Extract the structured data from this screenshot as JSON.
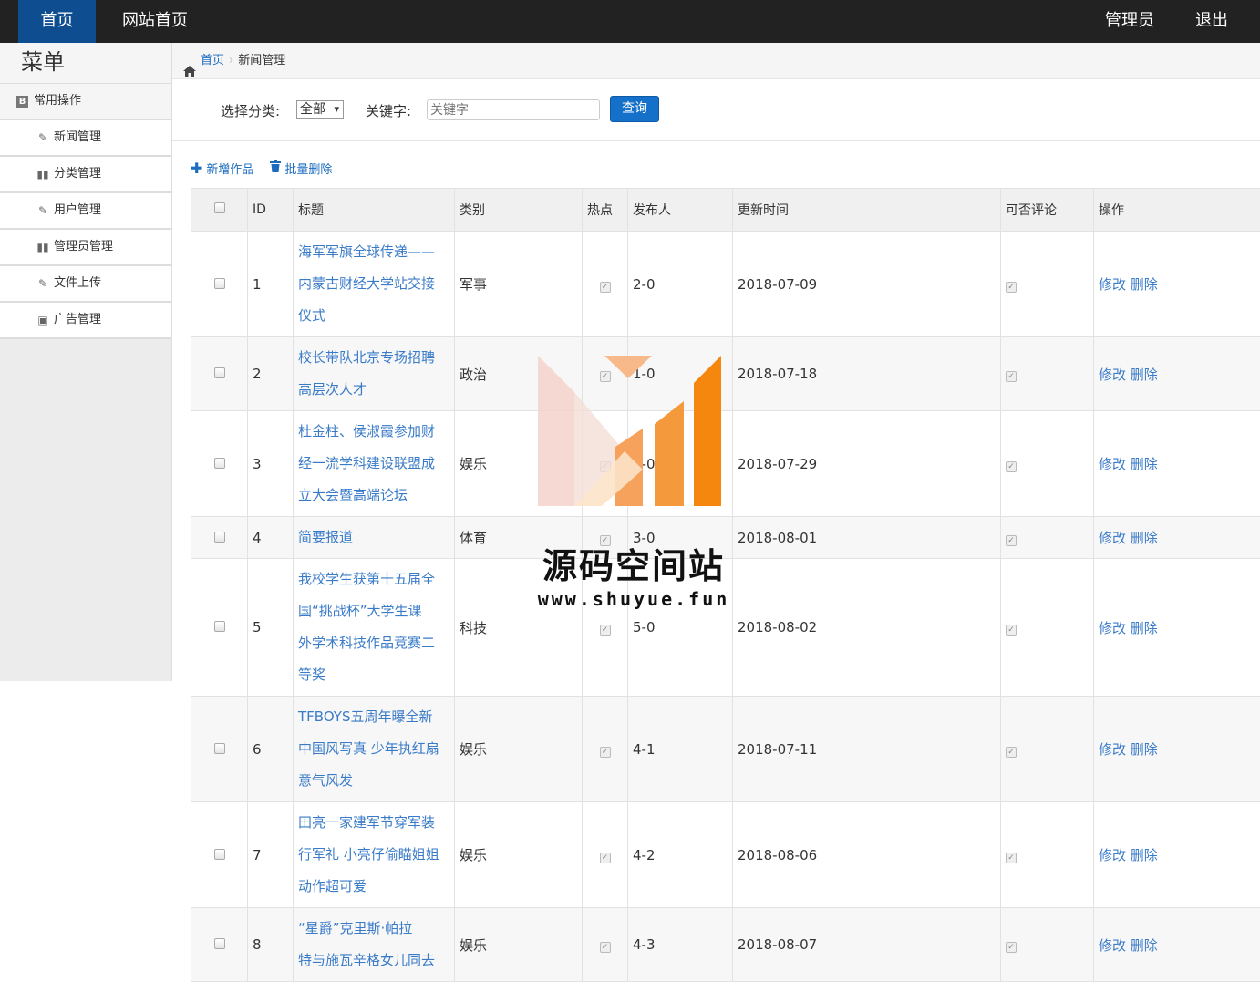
{
  "topnav": {
    "home": "首页",
    "site_home": "网站首页",
    "admin": "管理员",
    "logout": "退出"
  },
  "sidebar": {
    "title": "菜单",
    "group": "常用操作",
    "items": [
      {
        "label": "新闻管理",
        "icon": "brush-icon"
      },
      {
        "label": "分类管理",
        "icon": "books-icon"
      },
      {
        "label": "用户管理",
        "icon": "brush-icon"
      },
      {
        "label": "管理员管理",
        "icon": "books-icon"
      },
      {
        "label": "文件上传",
        "icon": "brush-icon"
      },
      {
        "label": "广告管理",
        "icon": "picture-icon"
      }
    ]
  },
  "breadcrumb": {
    "home": "首页",
    "current": "新闻管理"
  },
  "filter": {
    "category_label": "选择分类:",
    "category_value": "全部",
    "keyword_label": "关键字:",
    "keyword_placeholder": "关键字",
    "query_button": "查询"
  },
  "actions": {
    "add": "新增作品",
    "batch_delete": "批量删除"
  },
  "table": {
    "headers": [
      "ID",
      "标题",
      "类别",
      "热点",
      "发布人",
      "更新时间",
      "可否评论",
      "操作"
    ],
    "ops": {
      "edit": "修改",
      "delete": "删除"
    },
    "rows": [
      {
        "id": "1",
        "title": [
          "海军军旗全球传递——",
          "内蒙古财经大学站交接",
          "仪式"
        ],
        "category": "军事",
        "publisher": "2-0",
        "date": "2018-07-09"
      },
      {
        "id": "2",
        "title": [
          "校长带队北京专场招聘",
          "高层次人才"
        ],
        "category": "政治",
        "publisher": "1-0",
        "date": "2018-07-18"
      },
      {
        "id": "3",
        "title": [
          "杜金柱、侯淑霞参加财",
          "经一流学科建设联盟成",
          "立大会暨高端论坛"
        ],
        "category": "娱乐",
        "publisher": "2-0",
        "date": "2018-07-29"
      },
      {
        "id": "4",
        "title": [
          "简要报道"
        ],
        "category": "体育",
        "publisher": "3-0",
        "date": "2018-08-01"
      },
      {
        "id": "5",
        "title": [
          "我校学生获第十五届全",
          "国“挑战杯”大学生课",
          "外学术科技作品竞赛二",
          "等奖"
        ],
        "category": "科技",
        "publisher": "5-0",
        "date": "2018-08-02"
      },
      {
        "id": "6",
        "title": [
          "TFBOYS五周年曝全新",
          "中国风写真 少年执红扇",
          "意气风发"
        ],
        "category": "娱乐",
        "publisher": "4-1",
        "date": "2018-07-11"
      },
      {
        "id": "7",
        "title": [
          "田亮一家建军节穿军装",
          "行军礼 小亮仔偷瞄姐姐",
          "动作超可爱"
        ],
        "category": "娱乐",
        "publisher": "4-2",
        "date": "2018-08-06"
      },
      {
        "id": "8",
        "title": [
          "“星爵”克里斯·帕拉",
          "特与施瓦辛格女儿同去"
        ],
        "category": "娱乐",
        "publisher": "4-3",
        "date": "2018-08-07"
      }
    ]
  },
  "watermark": {
    "name": "源码空间站",
    "url": "www.shuyue.fun"
  }
}
